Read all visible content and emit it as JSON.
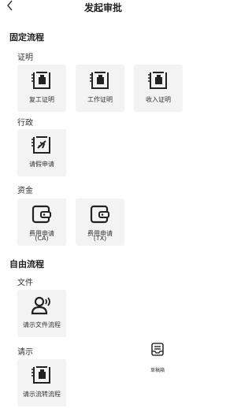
{
  "header": {
    "title": "发起审批",
    "back_icon": "chevron-left-icon"
  },
  "fixed_flow": {
    "title": "固定流程",
    "groups": [
      {
        "name": "证明",
        "items": [
          "复工证明",
          "工作证明",
          "收入证明"
        ]
      },
      {
        "name": "行政",
        "items": [
          "请假申请"
        ]
      },
      {
        "name": "资金",
        "items": [
          {
            "line1": "费用申请",
            "line2": "(CA)"
          },
          {
            "line1": "费用申请",
            "line2": "(TX)"
          }
        ]
      }
    ]
  },
  "free_flow": {
    "title": "自由流程",
    "groups": [
      {
        "name": "文件",
        "items": [
          "请示文件流程"
        ]
      },
      {
        "name": "请示",
        "items": [
          "请示流转流程"
        ]
      }
    ]
  },
  "drafts": {
    "label": "草稿箱",
    "icon": "inbox-tray-icon"
  }
}
